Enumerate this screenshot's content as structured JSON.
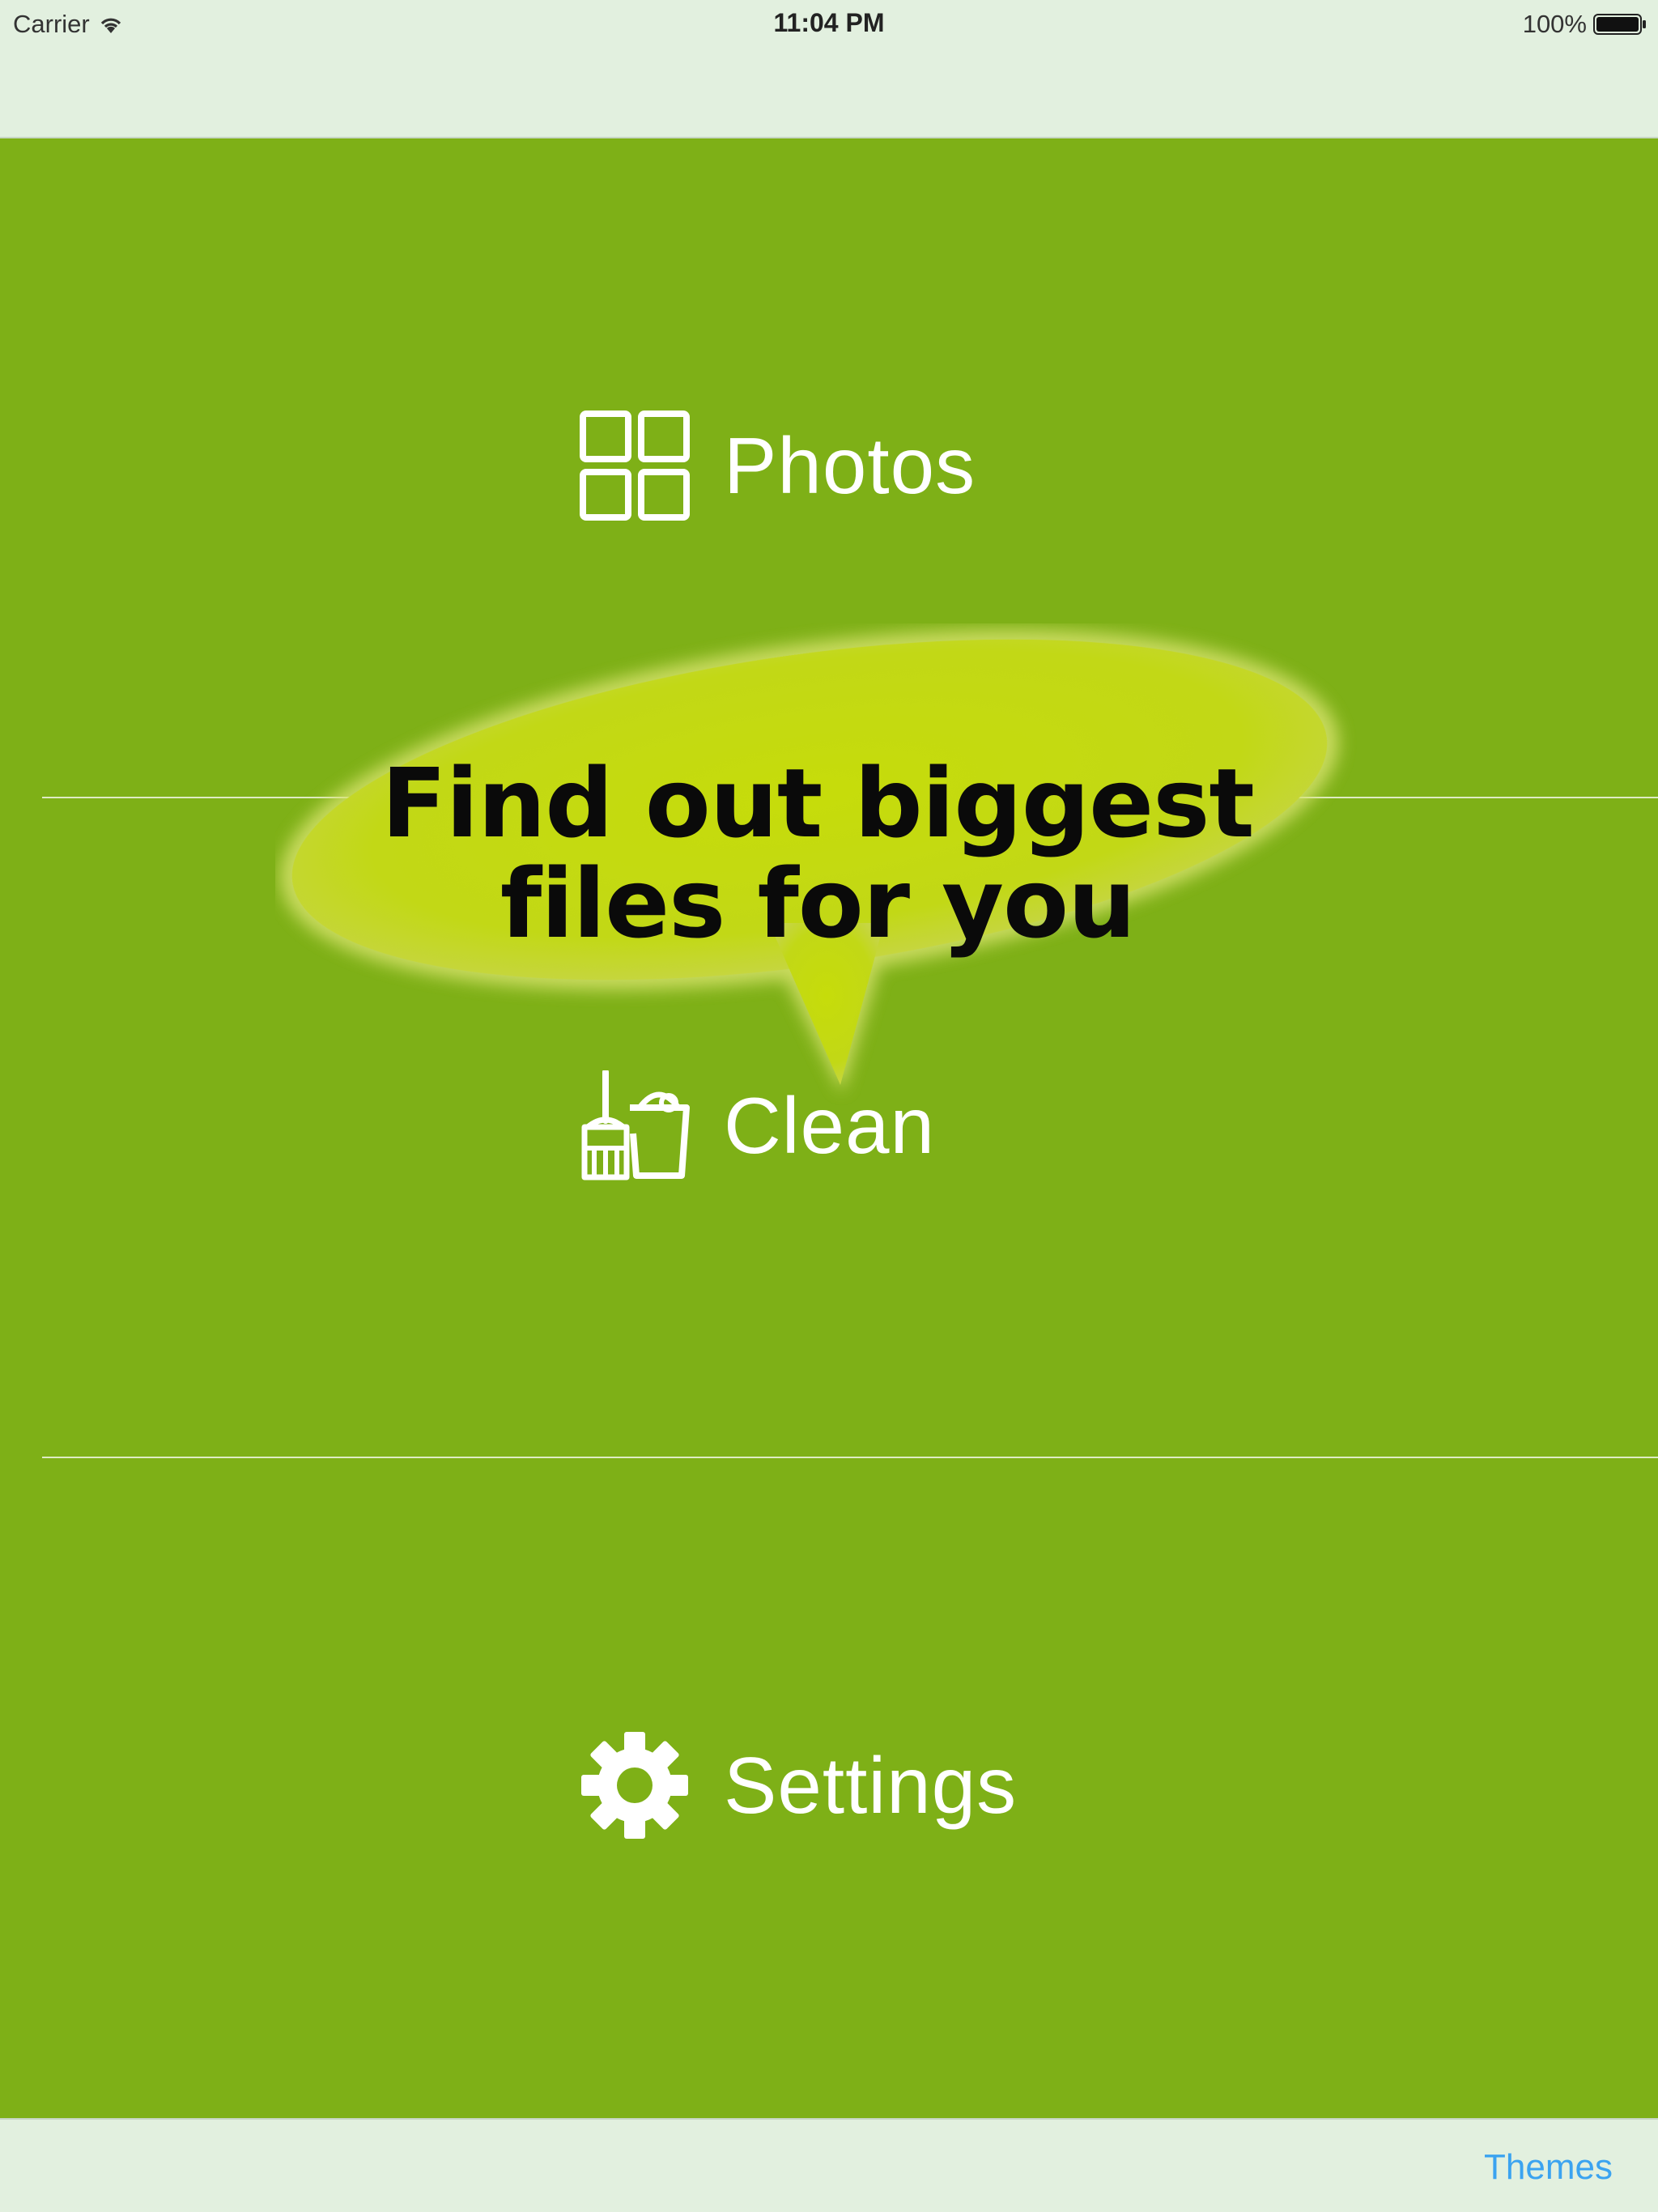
{
  "status_bar": {
    "carrier": "Carrier",
    "time": "11:04 PM",
    "battery": "100%"
  },
  "menu": {
    "items": [
      {
        "label": "Photos",
        "icon": "photos-grid-icon"
      },
      {
        "label": "Clean",
        "icon": "broom-bucket-icon"
      },
      {
        "label": "Settings",
        "icon": "gear-icon"
      }
    ]
  },
  "bubble": {
    "text": "Find out biggest\nfiles for you"
  },
  "toolbar": {
    "themes_label": "Themes"
  },
  "colors": {
    "background": "#7eb017",
    "bar": "#e2f0df",
    "bubble": "#c4d80e",
    "accent": "#3ba3f0"
  }
}
